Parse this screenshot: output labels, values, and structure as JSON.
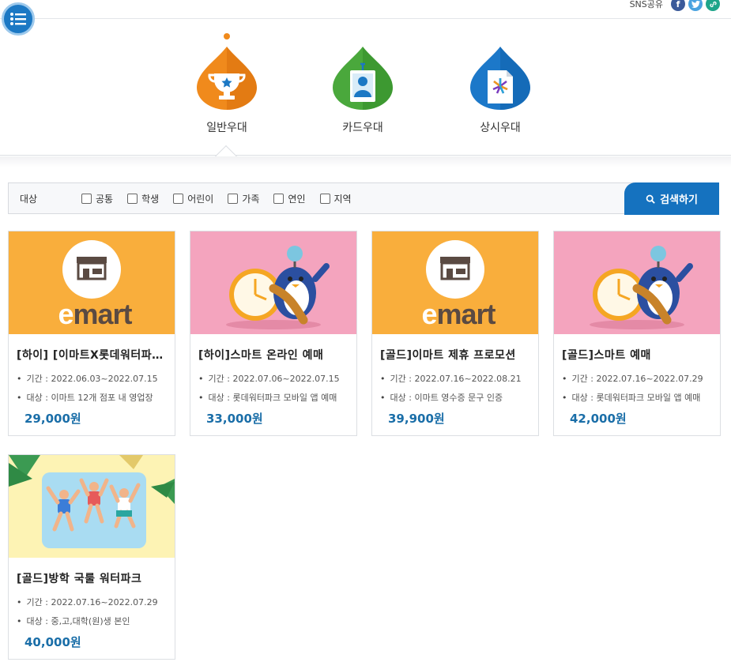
{
  "header": {
    "sns_label": "SNS공유",
    "sns_icons": [
      "facebook-icon",
      "twitter-icon",
      "link-icon"
    ]
  },
  "categories": [
    {
      "label": "일반우대",
      "icon": "trophy-icon",
      "color": "#f08a1c",
      "selected": true
    },
    {
      "label": "카드우대",
      "icon": "id-card-icon",
      "color": "#4aa83c",
      "selected": false
    },
    {
      "label": "상시우대",
      "icon": "document-icon",
      "color": "#1c78c9",
      "selected": false
    }
  ],
  "filter": {
    "title": "대상",
    "options": [
      "공통",
      "학생",
      "어린이",
      "가족",
      "연인",
      "지역"
    ],
    "search_label": "검색하기"
  },
  "cards": [
    {
      "title": "[하이] [이마트X롯데워터파크]",
      "period_label": "기간 :",
      "period": "2022.06.03~2022.07.15",
      "target_label": "대상 :",
      "target": "이마트 12개 점포 내 영업장",
      "price": "29,000원",
      "image": "emart"
    },
    {
      "title": "[하이]스마트 온라인 예매",
      "period_label": "기간 :",
      "period": "2022.07.06~2022.07.15",
      "target_label": "대상 :",
      "target": "롯데워터파크 모바일 앱 예매",
      "price": "33,000원",
      "image": "penguin"
    },
    {
      "title": "[골드]이마트 제휴 프로모션",
      "period_label": "기간 :",
      "period": "2022.07.16~2022.08.21",
      "target_label": "대상 :",
      "target": "이마트 영수증 문구 인증",
      "price": "39,900원",
      "image": "emart"
    },
    {
      "title": "[골드]스마트 예매",
      "period_label": "기간 :",
      "period": "2022.07.16~2022.07.29",
      "target_label": "대상 :",
      "target": "롯데워터파크 모바일 앱 예매",
      "price": "42,000원",
      "image": "penguin"
    },
    {
      "title": "[골드]방학 국룰 워터파크",
      "period_label": "기간 :",
      "period": "2022.07.16~2022.07.29",
      "target_label": "대상 :",
      "target": "중,고,대학(원)생 본인",
      "price": "40,000원",
      "image": "pool"
    }
  ],
  "emart_logo_text": "emart"
}
